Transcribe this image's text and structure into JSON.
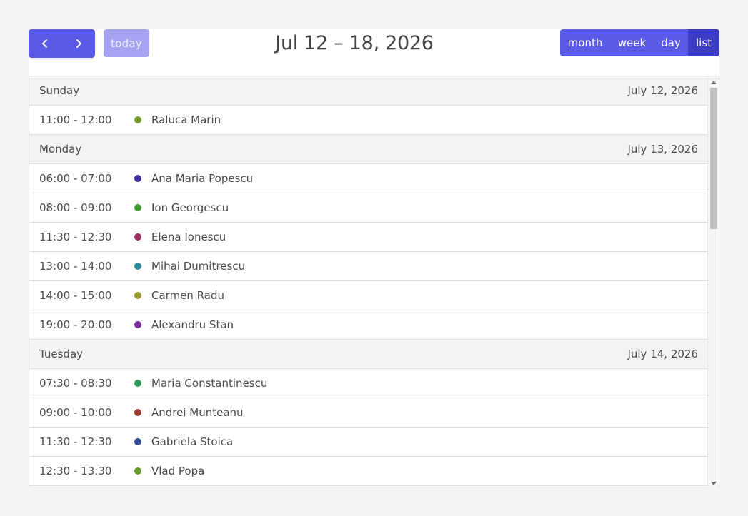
{
  "toolbar": {
    "prev_icon": "chevron-left-icon",
    "next_icon": "chevron-right-icon",
    "today_label": "today",
    "title": "Jul 12 – 18, 2026",
    "views": [
      "month",
      "week",
      "day",
      "list"
    ],
    "active_view": "list"
  },
  "colors": {
    "accent": "#5a5ae6",
    "accent_active": "#3b3bc4",
    "today_disabled": "#a5a3f2"
  },
  "list": [
    {
      "type": "day",
      "name": "Sunday",
      "date": "July 12, 2026"
    },
    {
      "type": "event",
      "time": "11:00 - 12:00",
      "title": "Raluca Marin",
      "color": "#7a9a2e"
    },
    {
      "type": "day",
      "name": "Monday",
      "date": "July 13, 2026"
    },
    {
      "type": "event",
      "time": "06:00 - 07:00",
      "title": "Ana Maria Popescu",
      "color": "#3a2e9c"
    },
    {
      "type": "event",
      "time": "08:00 - 09:00",
      "title": "Ion Georgescu",
      "color": "#3f9a2e"
    },
    {
      "type": "event",
      "time": "11:30 - 12:30",
      "title": "Elena Ionescu",
      "color": "#9a2e5e"
    },
    {
      "type": "event",
      "time": "13:00 - 14:00",
      "title": "Mihai Dumitrescu",
      "color": "#2e8a9a"
    },
    {
      "type": "event",
      "time": "14:00 - 15:00",
      "title": "Carmen Radu",
      "color": "#9a9a2e"
    },
    {
      "type": "event",
      "time": "19:00 - 20:00",
      "title": "Alexandru Stan",
      "color": "#7a2e9a"
    },
    {
      "type": "day",
      "name": "Tuesday",
      "date": "July 14, 2026"
    },
    {
      "type": "event",
      "time": "07:30 - 08:30",
      "title": "Maria Constantinescu",
      "color": "#2e9a5a"
    },
    {
      "type": "event",
      "time": "09:00 - 10:00",
      "title": "Andrei Munteanu",
      "color": "#9a3a2e"
    },
    {
      "type": "event",
      "time": "11:30 - 12:30",
      "title": "Gabriela Stoica",
      "color": "#2e4a9a"
    },
    {
      "type": "event",
      "time": "12:30 - 13:30",
      "title": "Vlad Popa",
      "color": "#6a9a2e"
    }
  ]
}
